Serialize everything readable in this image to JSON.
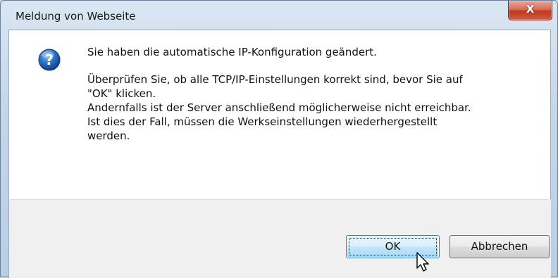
{
  "window": {
    "title": "Meldung von Webseite",
    "close_label": "X"
  },
  "message": {
    "line1": "Sie haben die automatische IP-Konfiguration geändert.",
    "line2": "Überprüfen Sie, ob alle TCP/IP-Einstellungen korrekt sind, bevor Sie auf",
    "line3": "\"OK\" klicken.",
    "line4": "Andernfalls ist der Server anschließend möglicherweise nicht erreichbar.",
    "line5": "Ist dies der Fall, müssen die Werkseinstellungen wiederhergestellt",
    "line6": "werden."
  },
  "buttons": {
    "ok_label": "OK",
    "cancel_label": "Abbrechen"
  },
  "icons": {
    "dialog_icon": "question-icon",
    "cursor": "mouse-pointer-icon"
  },
  "colors": {
    "icon_blue": "#1f63b8",
    "close_red": "#c1391f"
  }
}
